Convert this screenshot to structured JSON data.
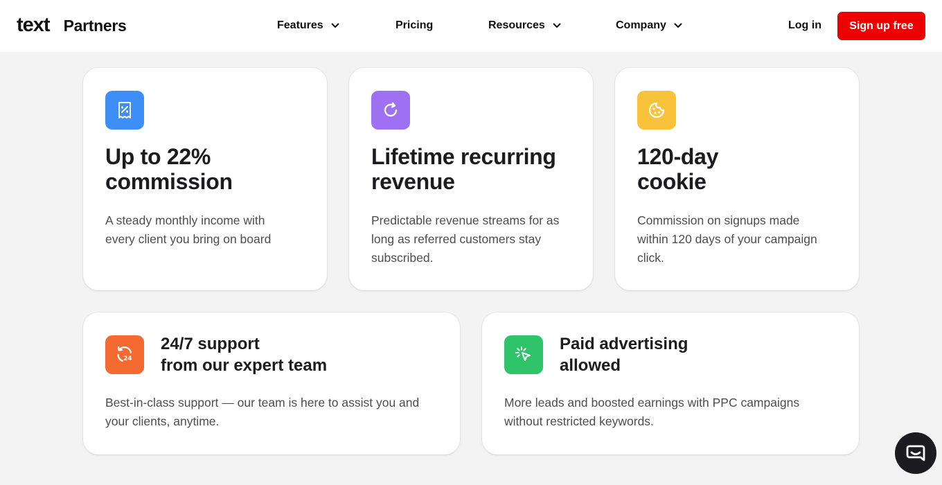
{
  "header": {
    "logo_text": "text",
    "logo_sub": "Partners",
    "nav": [
      {
        "label": "Features",
        "has_dropdown": true
      },
      {
        "label": "Pricing",
        "has_dropdown": false
      },
      {
        "label": "Resources",
        "has_dropdown": true
      },
      {
        "label": "Company",
        "has_dropdown": true
      }
    ],
    "login_label": "Log in",
    "signup_label": "Sign up free",
    "signup_color": "#ee0000"
  },
  "cards": [
    {
      "icon": "receipt-percent-icon",
      "icon_color": "#3d8ef7",
      "title_line1": "Up to 22%",
      "title_line2": "commission",
      "desc_line1": "A steady monthly income with",
      "desc_line2": "every client you bring on board",
      "desc_line3": ""
    },
    {
      "icon": "refresh-icon",
      "icon_color": "#a070f2",
      "title_line1": "Lifetime recurring",
      "title_line2": "revenue",
      "desc_line1": "Predictable revenue streams for as",
      "desc_line2": "long as referred customers stay",
      "desc_line3": "subscribed."
    },
    {
      "icon": "cookie-icon",
      "icon_color": "#f8c33a",
      "title_line1": "120-day",
      "title_line2": "cookie",
      "desc_line1": "Commission on signups made",
      "desc_line2": "within 120 days of your campaign",
      "desc_line3": "click."
    },
    {
      "icon": "support-24-icon",
      "icon_color": "#f56a30",
      "title_line1": "24/7 support",
      "title_line2": "from our expert team",
      "desc_line1": "Best-in-class support — our team is here to assist you and",
      "desc_line2": "your clients, anytime."
    },
    {
      "icon": "cursor-click-icon",
      "icon_color": "#2fc46a",
      "title_line1": "Paid advertising",
      "title_line2": "allowed",
      "desc_line1": "More leads and boosted earnings with PPC campaigns",
      "desc_line2": "without restricted keywords."
    }
  ],
  "chat": {
    "icon": "chat-bubble-icon"
  }
}
